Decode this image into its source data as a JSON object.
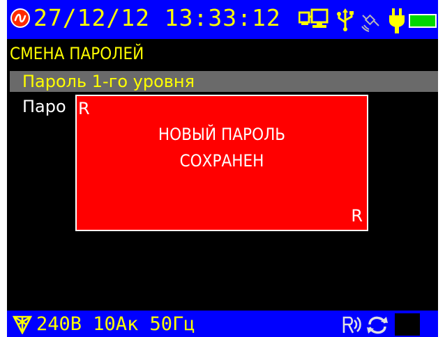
{
  "status_bar": {
    "datetime": "27/12/12 13:33:12",
    "icons": [
      "logo-icon",
      "pc-link-icon",
      "usb-icon",
      "satellite-icon",
      "plug-icon",
      "battery-icon"
    ],
    "battery_color": "#00d800"
  },
  "menu": {
    "title": "СМЕНА ПАРОЛЕЙ",
    "items": [
      {
        "label": "Пароль 1-го уровня",
        "selected": true
      },
      {
        "label": "Паро"
      }
    ]
  },
  "modal": {
    "corner_top_left": "R",
    "corner_bottom_right": "R",
    "line1": "НОВЫЙ ПАРОЛЬ",
    "line2": "СОХРАНЕН",
    "background": "#ff0000"
  },
  "bottom_bar": {
    "measurements": "240В 10Ак 50Гц",
    "icons": [
      "network-icon",
      "rec-icon",
      "sync-icon"
    ]
  },
  "colors": {
    "bar_blue": "#0000ff",
    "text_yellow": "#ffff00",
    "selection_gray": "#6a6a6a"
  }
}
